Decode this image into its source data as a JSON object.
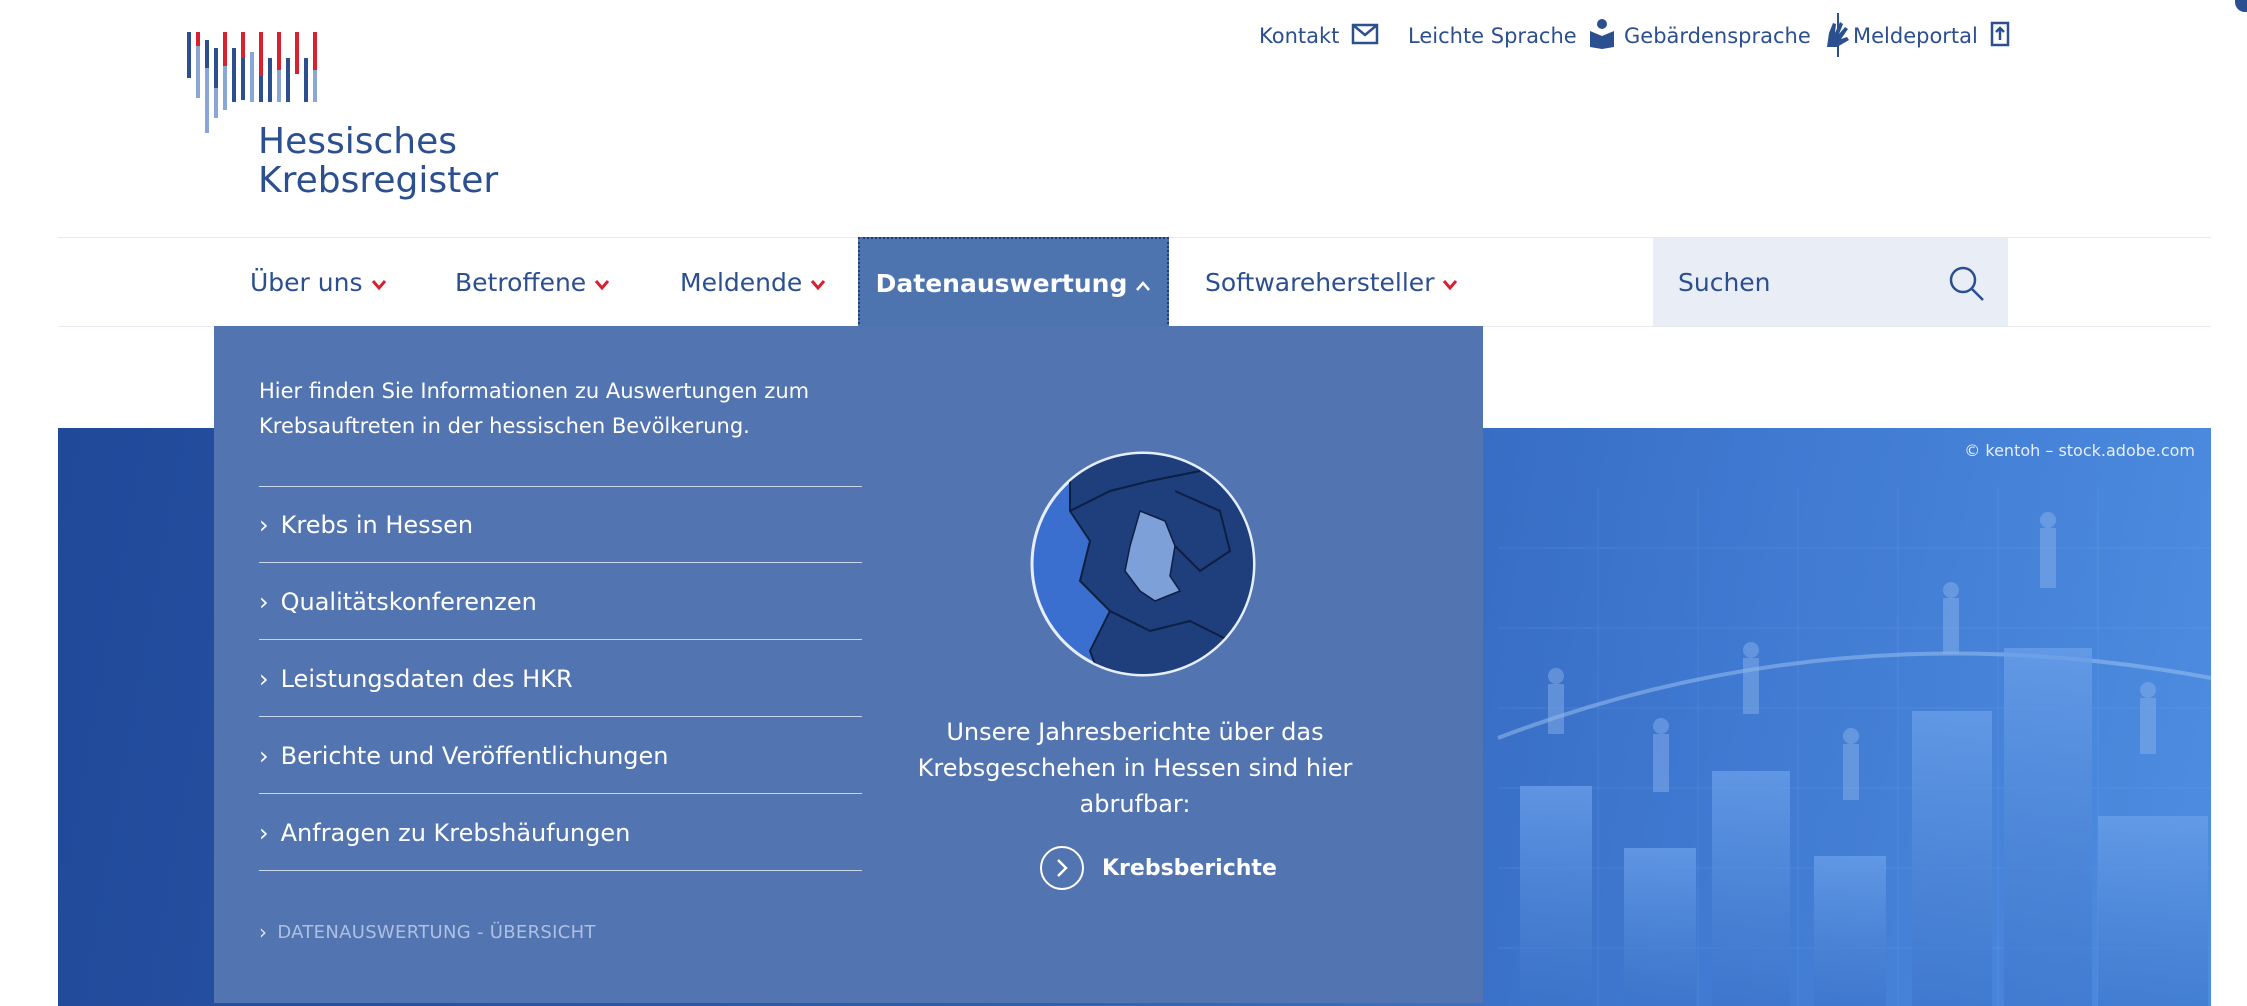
{
  "logo": {
    "line1": "Hessisches",
    "line2": "Krebsregister",
    "icon": "bar-lines-logo"
  },
  "utility_nav": [
    {
      "label": "Kontakt",
      "icon": "envelope-icon"
    },
    {
      "label": "Leichte Sprache",
      "icon": "reading-person-icon"
    },
    {
      "label": "Gebärdensprache",
      "icon": "sign-hands-icon"
    },
    {
      "label": "Meldeportal",
      "icon": "portal-icon"
    }
  ],
  "main_nav": {
    "items": [
      {
        "label": "Über uns",
        "expanded": false
      },
      {
        "label": "Betroffene",
        "expanded": false
      },
      {
        "label": "Meldende",
        "expanded": false
      },
      {
        "label": "Datenauswertung",
        "expanded": true
      },
      {
        "label": "Softwarehersteller",
        "expanded": false
      }
    ],
    "search_label": "Suchen"
  },
  "hero": {
    "credit": "© kentoh – stock.adobe.com"
  },
  "dropdown": {
    "intro": "Hier finden Sie Informationen zu Auswertungen zum Krebsauftreten in der hessischen Bevölkerung.",
    "links": [
      "Krebs in Hessen",
      "Qualitätskonferenzen",
      "Leistungsdaten des HKR",
      "Berichte und Veröffentlichungen",
      "Anfragen zu Krebshäufungen"
    ],
    "overview": "DATENAUSWERTUNG - ÜBERSICHT",
    "teaser_text": "Unsere Jahresberichte über das Krebsgeschehen in Hessen sind hier abrufbar:",
    "teaser_link": "Krebsberichte"
  },
  "colors": {
    "brand_blue": "#2b4f8f",
    "accent_red": "#d8202f",
    "menu_bg": "#5274b0",
    "light_bar": "#8aa6d6"
  }
}
